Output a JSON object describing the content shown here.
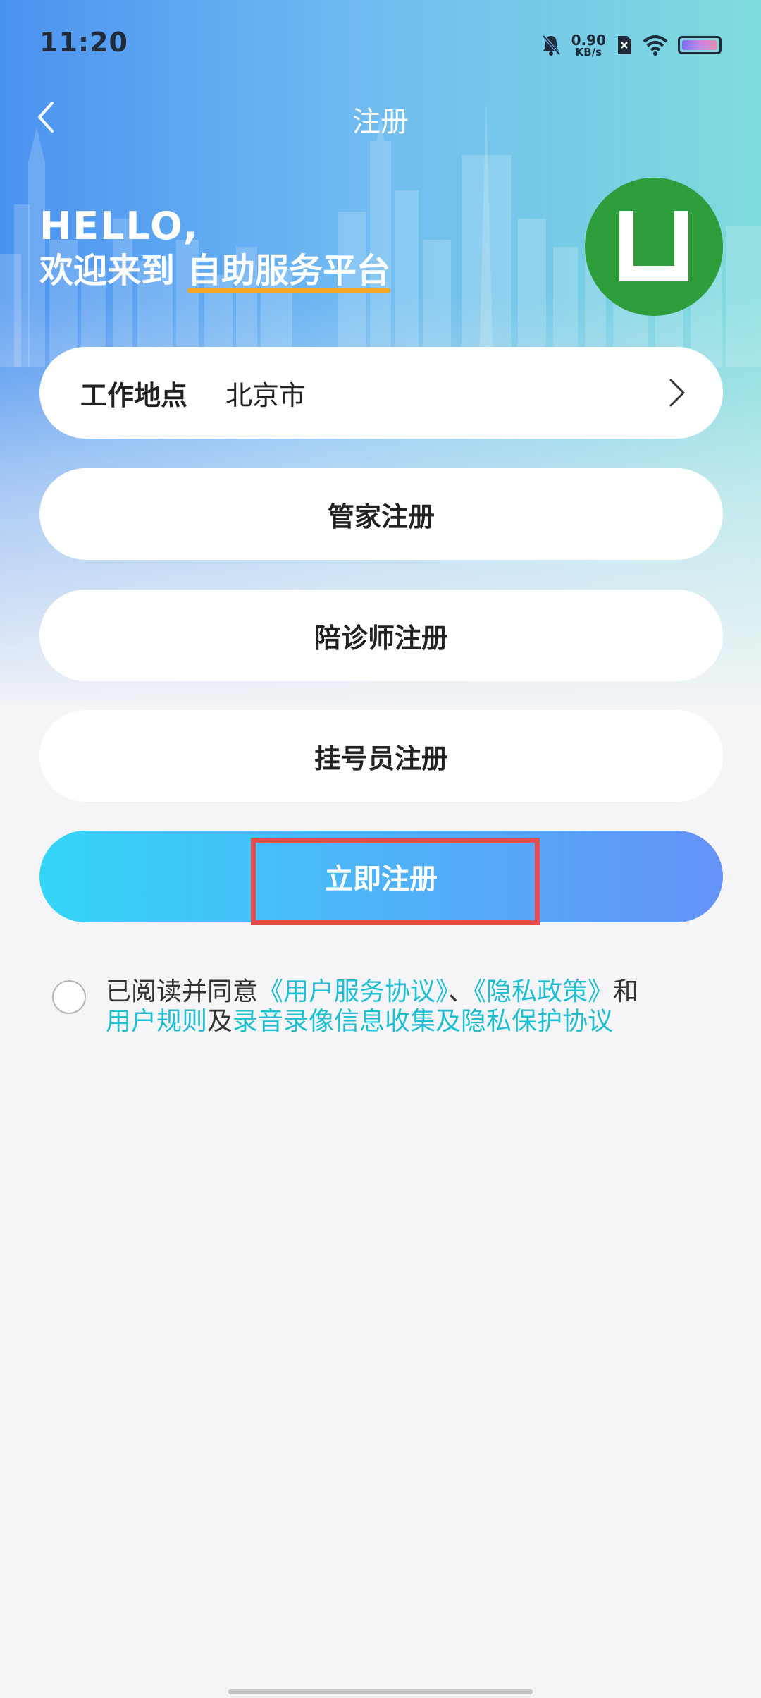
{
  "status_bar": {
    "time": "11:20",
    "net_speed_value": "0.90",
    "net_speed_unit": "KB/s",
    "icons": [
      "mute-bell-icon",
      "sim-x-icon",
      "wifi-icon",
      "battery-icon"
    ]
  },
  "nav": {
    "title": "注册",
    "back_icon": "chevron-left-icon"
  },
  "greeting": {
    "hello": "HELLO,",
    "welcome": "欢迎来到",
    "platform": "自助服务平台"
  },
  "logo": {
    "icon": "logo-u-icon",
    "color": "#2e9e3c"
  },
  "location": {
    "label": "工作地点",
    "value": "北京市"
  },
  "options": {
    "steward": "管家注册",
    "escort": "陪诊师注册",
    "registrar": "挂号员注册"
  },
  "submit": {
    "label": "立即注册"
  },
  "agreement": {
    "prefix": "已阅读并同意",
    "user_service": "《用户服务协议》",
    "sep1": "、",
    "privacy": "《隐私政策》",
    "and": "和",
    "user_rules": "用户规则",
    "and2": "及",
    "recording": "录音录像信息收集及隐私保护协议",
    "checked": false
  },
  "colors": {
    "link": "#1fbfd3",
    "accent_underline": "#f4a522",
    "highlight_box": "#e84b4b"
  }
}
